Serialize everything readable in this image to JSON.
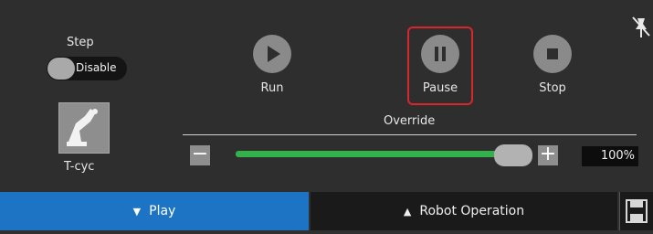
{
  "step": {
    "label": "Step",
    "toggle_text": "Disable"
  },
  "tcyc": {
    "label": "T-cyc",
    "icon": "robot-arm-icon"
  },
  "controls": {
    "run": {
      "label": "Run",
      "icon": "play-icon"
    },
    "pause": {
      "label": "Pause",
      "icon": "pause-icon"
    },
    "stop": {
      "label": "Stop",
      "icon": "stop-icon"
    }
  },
  "override": {
    "label": "Override",
    "value_text": "100%",
    "level_fraction": 1.0,
    "minus_label": "−",
    "plus_label": "+"
  },
  "bottom_bar": {
    "play_label": "Play",
    "robot_operation_label": "Robot Operation",
    "play_arrow": "▼",
    "robot_arrow": "▲"
  },
  "colors": {
    "highlight_frame": "#d6282b",
    "play_tab": "#1e74c4",
    "slider_track": "#33b14a"
  }
}
